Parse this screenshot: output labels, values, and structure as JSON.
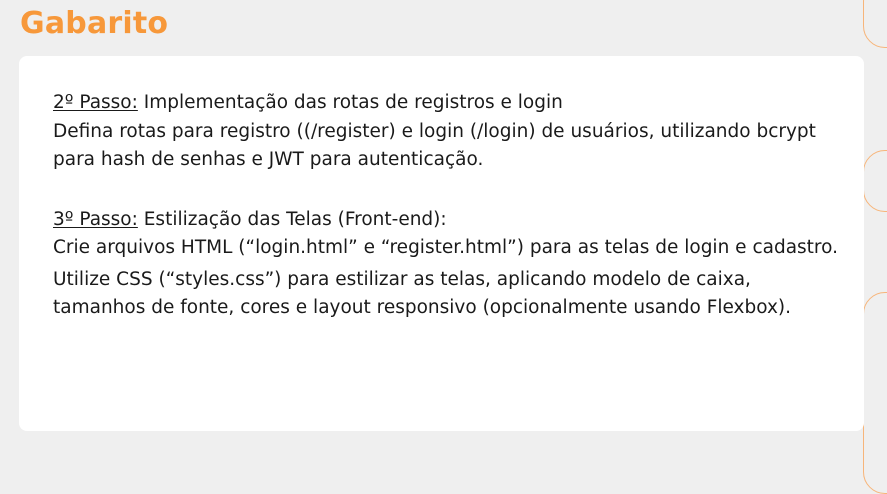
{
  "header": {
    "title": "Gabarito"
  },
  "steps": [
    {
      "label": "2º Passo:",
      "heading": " Implementação das rotas de registros e login",
      "paragraphs": [
        "Defina rotas para registro ((/register) e login (/login) de usuários, utilizando bcrypt para hash de senhas e JWT para autenticação."
      ]
    },
    {
      "label": "3º Passo:",
      "heading": " Estilização das Telas (Front-end):",
      "paragraphs": [
        "Crie arquivos HTML (“login.html” e “register.html”) para as telas de login e cadastro.",
        "Utilize CSS (“styles.css”) para estilizar as telas, aplicando modelo de caixa, tamanhos de fonte, cores e layout responsivo (opcionalmente usando Flexbox)."
      ]
    }
  ],
  "colors": {
    "accent": "#f7983a",
    "background": "#efefef",
    "card": "#ffffff",
    "text": "#1a1a1a"
  }
}
